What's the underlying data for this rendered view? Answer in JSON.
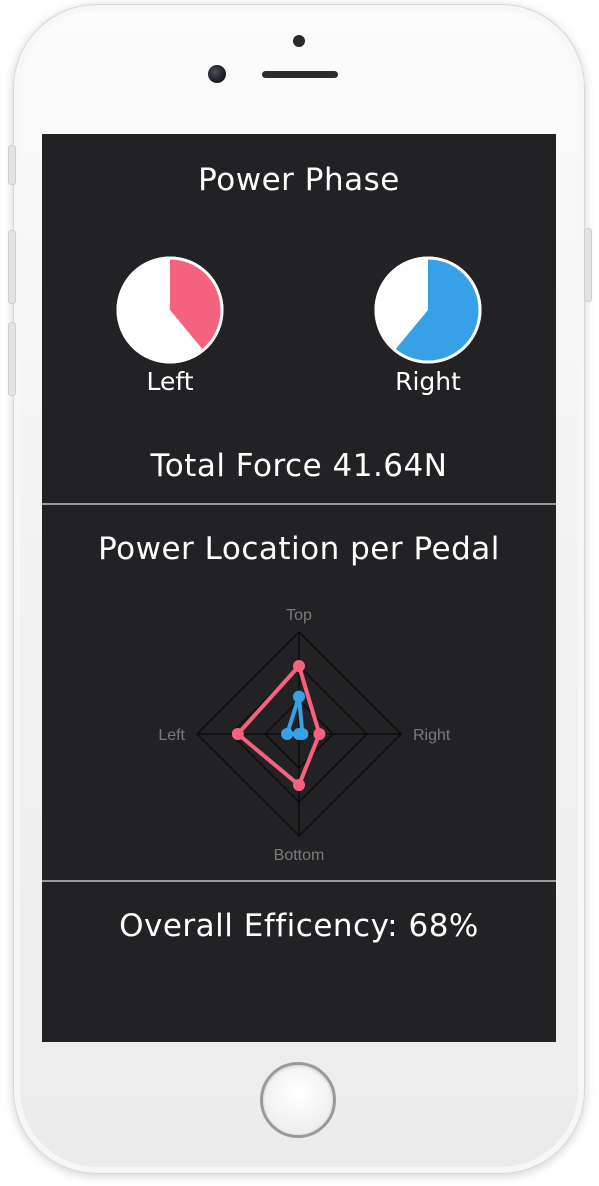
{
  "power_phase": {
    "title": "Power Phase",
    "left": {
      "label": "Left",
      "fraction": 0.39,
      "color": "#f5627e"
    },
    "right": {
      "label": "Right",
      "fraction": 0.61,
      "color": "#37a1e8"
    }
  },
  "total_force": {
    "text": "Total Force 41.64N"
  },
  "power_location": {
    "title": "Power Location per Pedal"
  },
  "chart_data": {
    "type": "radar",
    "axes": [
      "Top",
      "Right",
      "Bottom",
      "Left"
    ],
    "rmax": 3,
    "series": [
      {
        "values": [
          2.0,
          0.6,
          1.5,
          1.8
        ],
        "color": "#f5627e"
      },
      {
        "values": [
          1.1,
          0.1,
          0.0,
          0.35
        ],
        "color": "#37a1e8"
      }
    ]
  },
  "efficiency": {
    "text": "Overall Efficency: 68%"
  }
}
